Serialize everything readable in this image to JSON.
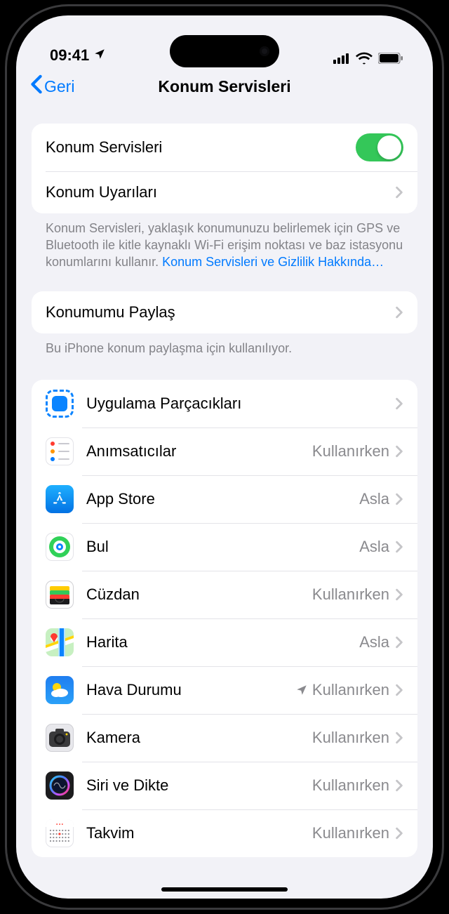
{
  "status": {
    "time": "09:41"
  },
  "nav": {
    "back": "Geri",
    "title": "Konum Servisleri"
  },
  "group1": {
    "locationServices": "Konum Servisleri",
    "locationAlerts": "Konum Uyarıları"
  },
  "footer1_text": "Konum Servisleri, yaklaşık konumunuzu belirlemek için GPS ve Bluetooth ile kitle kaynaklı Wi-Fi erişim noktası ve baz istasyonu konumlarını kullanır. ",
  "footer1_link": "Konum Servisleri ve Gizlilik Hakkında…",
  "group2": {
    "shareLocation": "Konumumu Paylaş"
  },
  "footer2": "Bu iPhone konum paylaşma için kullanılıyor.",
  "statusValues": {
    "whileUsing": "Kullanırken",
    "never": "Asla"
  },
  "apps": [
    {
      "id": "widgets",
      "name": "Uygulama Parçacıkları",
      "status": "",
      "arrow": false
    },
    {
      "id": "reminders",
      "name": "Anımsatıcılar",
      "status": "whileUsing",
      "arrow": false
    },
    {
      "id": "appstore",
      "name": "App Store",
      "status": "never",
      "arrow": false
    },
    {
      "id": "find",
      "name": "Bul",
      "status": "never",
      "arrow": false
    },
    {
      "id": "wallet",
      "name": "Cüzdan",
      "status": "whileUsing",
      "arrow": false
    },
    {
      "id": "maps",
      "name": "Harita",
      "status": "never",
      "arrow": false
    },
    {
      "id": "weather",
      "name": "Hava Durumu",
      "status": "whileUsing",
      "arrow": true
    },
    {
      "id": "camera",
      "name": "Kamera",
      "status": "whileUsing",
      "arrow": false
    },
    {
      "id": "siri",
      "name": "Siri ve Dikte",
      "status": "whileUsing",
      "arrow": false
    },
    {
      "id": "calendar",
      "name": "Takvim",
      "status": "whileUsing",
      "arrow": false
    }
  ]
}
